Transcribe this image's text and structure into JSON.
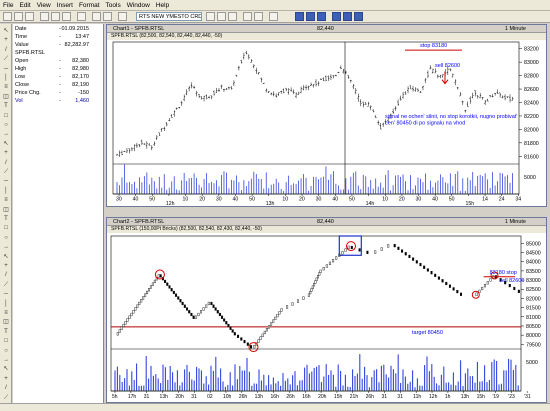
{
  "menu": [
    "File",
    "Edit",
    "View",
    "Insert",
    "Format",
    "Tools",
    "Window",
    "Help"
  ],
  "toolbar": {
    "symbol": "RTS NEW YMESTO CRDSX"
  },
  "info": {
    "header": [
      {
        "k": "Date",
        "d": "-",
        "v": "01.09.2015"
      },
      {
        "k": "Time",
        "d": "-",
        "v": "13:47"
      },
      {
        "k": "Value",
        "d": "-",
        "v": "82,282.97"
      }
    ],
    "symbol": "SPFB.RTSL",
    "rows": [
      {
        "k": "Open",
        "d": "-",
        "v": "82,380"
      },
      {
        "k": "High",
        "d": "-",
        "v": "82,980"
      },
      {
        "k": "Low",
        "d": "-",
        "v": "82,170"
      },
      {
        "k": "Close",
        "d": "-",
        "v": "82,190"
      },
      {
        "k": "Price Chg.",
        "d": "-",
        "v": "-150"
      },
      {
        "k": "Vol",
        "d": "-",
        "v": "1,460"
      }
    ]
  },
  "chart1": {
    "window_title": "Chart1 - SPFB.RTSL",
    "window_value": "82,440",
    "window_period": "1 Minute",
    "series_label": "SPFB.RTSL (82,500, 82,540, 82,440, 82,440, -50)",
    "annotations": {
      "stop": "stop 83180",
      "sell": "sell 82600",
      "comment_1": "signal ne ochen' silnii, no stop korotkii, nugno probivat'",
      "comment_2": "cen' 80450 di po signalu na vhod"
    }
  },
  "chart2": {
    "window_title": "Chart2 - SPFB.RTSL",
    "window_value": "82,440",
    "window_period": "1 Minute",
    "series_label": "SPFB.RTSL (150,00Pt Bricks) (82,500, 82,540, 82,430, 82,440, -50)",
    "annotations": {
      "stop": "83180 stop",
      "sell": "sell 82600",
      "target": "target 80450"
    }
  },
  "chart_data": [
    {
      "type": "candlestick",
      "title": "",
      "y_ticks": [
        81600,
        81800,
        82000,
        82200,
        82400,
        82600,
        82800,
        83000,
        83200
      ],
      "ylim": [
        81500,
        83300
      ],
      "x_tick_labels": [
        "30",
        "40",
        "50",
        "12h",
        "10",
        "20",
        "30",
        "40",
        "50",
        "13h",
        "10",
        "20",
        "30",
        "40",
        "50",
        "14h",
        "10",
        "20",
        "30",
        "40",
        "50",
        "15h",
        "14",
        "24",
        "34"
      ],
      "price_path": [
        [
          0,
          81620
        ],
        [
          5,
          81700
        ],
        [
          10,
          81800
        ],
        [
          14,
          81740
        ],
        [
          18,
          81990
        ],
        [
          22,
          82200
        ],
        [
          26,
          82400
        ],
        [
          30,
          82660
        ],
        [
          34,
          82460
        ],
        [
          38,
          82510
        ],
        [
          42,
          82620
        ],
        [
          46,
          82600
        ],
        [
          50,
          83000
        ],
        [
          52,
          83150
        ],
        [
          56,
          82900
        ],
        [
          60,
          82600
        ],
        [
          64,
          82500
        ],
        [
          68,
          82600
        ],
        [
          72,
          82510
        ],
        [
          76,
          82650
        ],
        [
          80,
          82680
        ],
        [
          84,
          82760
        ],
        [
          88,
          82800
        ],
        [
          90,
          82930
        ],
        [
          94,
          82720
        ],
        [
          98,
          82400
        ],
        [
          102,
          82350
        ],
        [
          106,
          82030
        ],
        [
          110,
          82200
        ],
        [
          114,
          82460
        ],
        [
          118,
          82620
        ],
        [
          122,
          82570
        ],
        [
          126,
          82900
        ],
        [
          130,
          82780
        ],
        [
          134,
          82900
        ],
        [
          136,
          82700
        ],
        [
          140,
          82300
        ],
        [
          144,
          82560
        ],
        [
          148,
          82410
        ],
        [
          152,
          82550
        ],
        [
          156,
          82480
        ],
        [
          160,
          82430
        ]
      ],
      "h_lines": [
        {
          "label": "stop 83180",
          "value": 83180
        }
      ]
    },
    {
      "type": "renko",
      "title": "",
      "brick_size": 150,
      "y_ticks": [
        79500,
        80000,
        80500,
        81000,
        81500,
        82000,
        82500,
        83000,
        83500,
        84000,
        84500,
        85000
      ],
      "ylim": [
        79300,
        85400
      ],
      "x_tick_labels": [
        "5h",
        "17h",
        "31",
        "13h",
        "20h",
        "31",
        "02",
        "10h",
        "26h",
        "13h",
        "16h",
        "26h",
        "16h",
        "20h",
        "15h",
        "21h",
        "26h",
        "31",
        "31",
        "11h",
        "12h",
        "1h",
        "13h",
        "15h",
        "'19",
        "'23",
        "'31"
      ],
      "brick_path": [
        [
          0,
          80000
        ],
        [
          55,
          83300
        ],
        [
          100,
          80900
        ],
        [
          120,
          81800
        ],
        [
          150,
          80150
        ],
        [
          175,
          79300
        ],
        [
          210,
          81300
        ],
        [
          245,
          82100
        ],
        [
          260,
          83400
        ],
        [
          300,
          84850
        ],
        [
          330,
          84450
        ],
        [
          355,
          84950
        ],
        [
          440,
          82300
        ],
        [
          460,
          82150
        ],
        [
          485,
          83250
        ],
        [
          520,
          82300
        ]
      ],
      "h_lines": [
        {
          "label": "target 80450",
          "value": 80450
        },
        {
          "label": "83180 stop",
          "value": 83180
        }
      ]
    }
  ],
  "colors": {
    "up_brick": "#ffffff",
    "down_brick": "#000000",
    "annotation": "#0000ff",
    "stop_line": "#d00000",
    "target_line": "#b00000",
    "volume": "#3344dd",
    "circle": "#dd0000",
    "highlight": "#1f2fd0"
  }
}
